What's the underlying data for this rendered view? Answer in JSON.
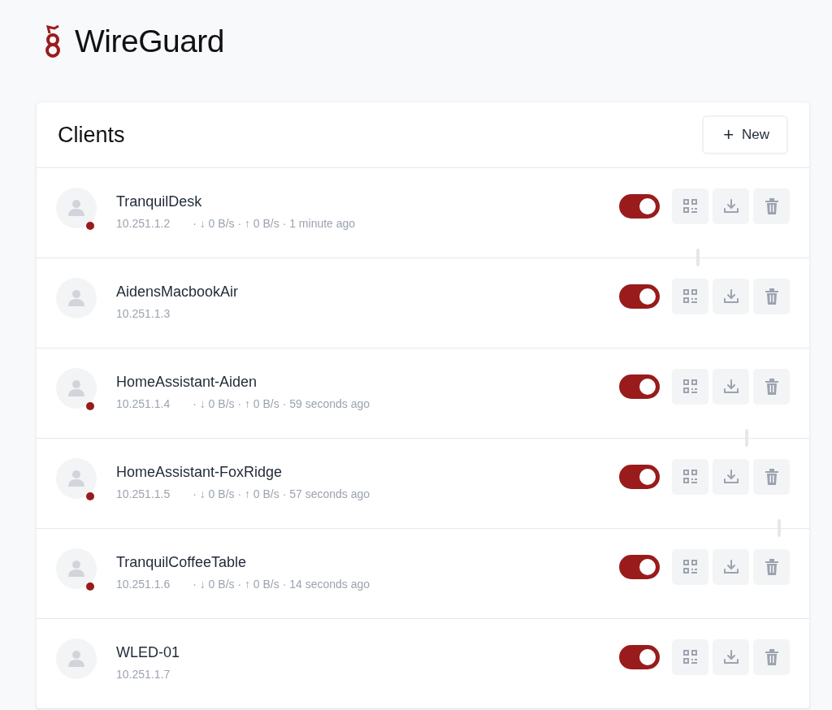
{
  "app": {
    "title": "WireGuard"
  },
  "clients_panel": {
    "title": "Clients",
    "new_button": {
      "icon": "+",
      "label": "New"
    }
  },
  "clients": [
    {
      "name": "TranquilDesk",
      "address": "10.251.1.2",
      "online": true,
      "stats": "· ↓ 0 B/s · ↑ 0 B/s · 1 minute ago",
      "enabled": true,
      "traffic_graph": true
    },
    {
      "name": "AidensMacbookAir",
      "address": "10.251.1.3",
      "online": false,
      "enabled": true,
      "traffic_graph": false
    },
    {
      "name": "HomeAssistant-Aiden",
      "address": "10.251.1.4",
      "online": true,
      "stats": "· ↓ 0 B/s · ↑ 0 B/s · 59 seconds ago",
      "enabled": true,
      "traffic_graph": true
    },
    {
      "name": "HomeAssistant-FoxRidge",
      "address": "10.251.1.5",
      "online": true,
      "stats": "· ↓ 0 B/s · ↑ 0 B/s · 57 seconds ago",
      "enabled": true,
      "traffic_graph": true
    },
    {
      "name": "TranquilCoffeeTable",
      "address": "10.251.1.6",
      "online": true,
      "stats": "· ↓ 0 B/s · ↑ 0 B/s · 14 seconds ago",
      "enabled": true,
      "traffic_graph": false
    },
    {
      "name": "WLED-01",
      "address": "10.251.1.7",
      "online": false,
      "enabled": true,
      "traffic_graph": false
    }
  ]
}
